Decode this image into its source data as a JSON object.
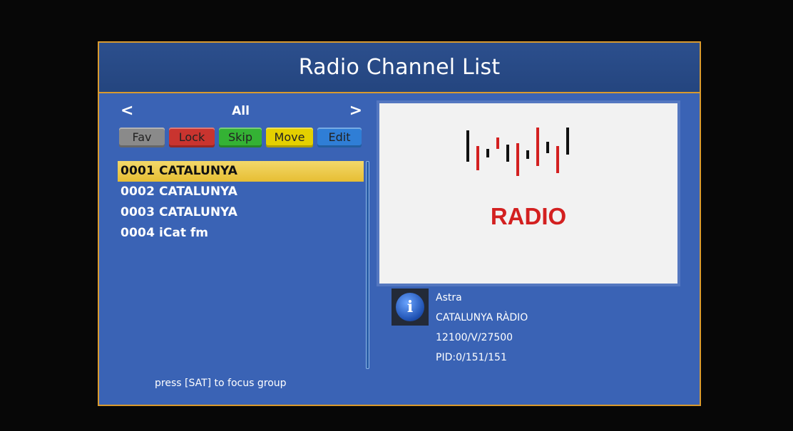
{
  "title": "Radio Channel List",
  "group": {
    "name": "All",
    "left_arrow": "<",
    "right_arrow": ">"
  },
  "buttons": {
    "fav": {
      "label": "Fav",
      "color": "#8a8a8a"
    },
    "lock": {
      "label": "Lock",
      "color": "#c9342f"
    },
    "skip": {
      "label": "Skip",
      "color": "#34b234"
    },
    "move": {
      "label": "Move",
      "color": "#e4d000"
    },
    "edit": {
      "label": "Edit",
      "color": "#2f7ed6"
    }
  },
  "channels": [
    {
      "number": "0001",
      "name": "CATALUNYA",
      "selected": true
    },
    {
      "number": "0002",
      "name": "CATALUNYA",
      "selected": false
    },
    {
      "number": "0003",
      "name": "CATALUNYA",
      "selected": false
    },
    {
      "number": "0004",
      "name": "iCat fm",
      "selected": false
    }
  ],
  "hint": "press [SAT] to focus group",
  "preview": {
    "logo_text": "RADIO",
    "logo_color": "#d32020"
  },
  "info": {
    "icon": "info-icon",
    "icon_glyph": "i",
    "satellite": "Astra",
    "channel_name": "CATALUNYA RÀDIO",
    "frequency": "12100/V/27500",
    "pid": "PID:0/151/151"
  },
  "colors": {
    "panel_bg": "#3a63b5",
    "title_bg": "#24457f",
    "border": "#d99a2e",
    "selection": "#e7be33"
  }
}
